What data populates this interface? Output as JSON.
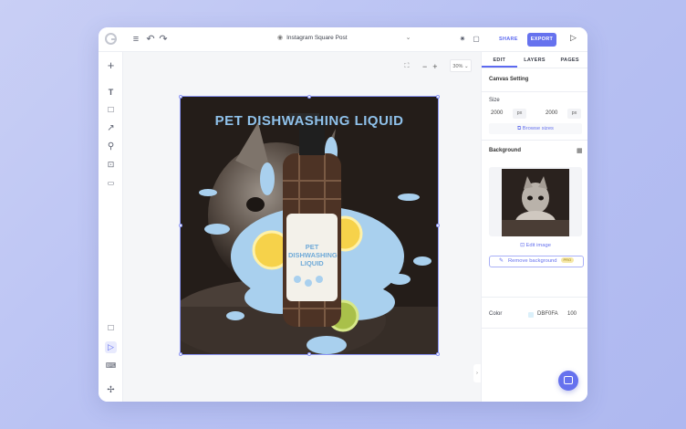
{
  "topbar": {
    "doc_title": "Instagram Square Post",
    "share_label": "SHARE",
    "export_label": "EXPORT"
  },
  "canvas": {
    "zoom": "30%",
    "zoom_out": "−",
    "zoom_in": "+",
    "headline": "PET DISHWASHING LIQUID",
    "bottle_label_line1": "PET",
    "bottle_label_line2": "DISHWASHING",
    "bottle_label_line3": "LIQUID",
    "splash_color": "#a9d0ee"
  },
  "panel": {
    "tabs": [
      "EDIT",
      "LAYERS",
      "PAGES"
    ],
    "canvas_setting_title": "Canvas Setting",
    "size_label": "Size",
    "width_value": "2000",
    "width_unit": "px",
    "height_value": "2000",
    "height_unit": "px",
    "browse_sizes": "Browse sizes",
    "background_title": "Background",
    "edit_image": "Edit image",
    "remove_background": "Remove background",
    "remove_background_badge": "PRO",
    "color_label": "Color",
    "color_hex": "DBF0FA",
    "color_opacity": "100"
  },
  "colors": {
    "accent": "#6672ee",
    "bg_color": "#DBF0FA"
  }
}
